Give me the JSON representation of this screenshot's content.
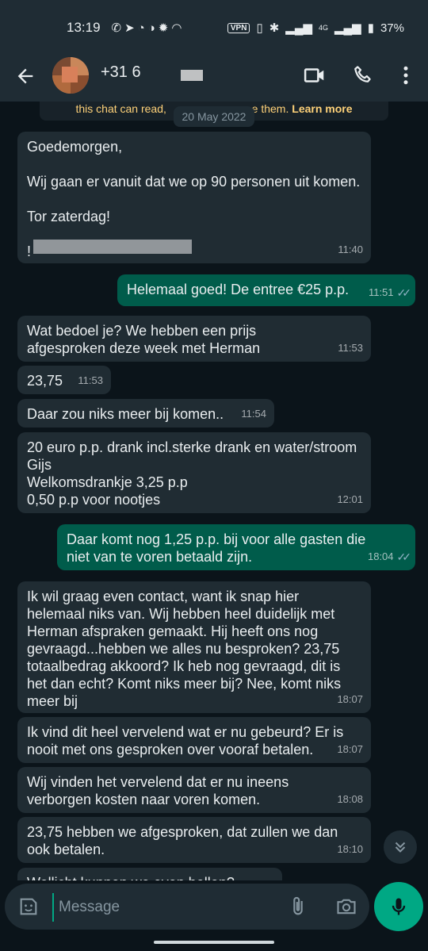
{
  "status_bar": {
    "time": "13:19",
    "notification_icons": [
      "whatsapp-icon",
      "telegram-icon",
      "c-icon",
      "opera-icon",
      "gear-icon",
      "arc-icon"
    ],
    "vpn": "VPN",
    "network": "4G",
    "battery": "37%"
  },
  "header": {
    "contact_name": "+31 6",
    "icons": [
      "back-arrow-icon",
      "video-call-icon",
      "phone-icon",
      "more-vert-icon"
    ]
  },
  "encryption_note": {
    "text_start": "this chat can read, ",
    "text_end": "e them.",
    "link": "Learn more"
  },
  "date_divider": "20 May 2022",
  "messages": [
    {
      "dir": "in",
      "text": "Goedemorgen,\n\nWij gaan er vanuit dat we op 90 personen uit komen.\n\nTor zaterdag!\n\n!",
      "time": "11:40"
    },
    {
      "dir": "out",
      "text": "Helemaal goed! De entree €25 p.p.",
      "time": "11:51",
      "read": true
    },
    {
      "dir": "in",
      "text": "Wat bedoel je? We hebben een prijs afgesproken deze week met Herman",
      "time": "11:53"
    },
    {
      "dir": "in",
      "text": "23,75",
      "time": "11:53"
    },
    {
      "dir": "in",
      "text": "Daar zou niks meer bij komen..",
      "time": "11:54"
    },
    {
      "dir": "in",
      "text": "20 euro p.p. drank incl.sterke drank en water/stroom Gijs\nWelkomsdrankje 3,25 p.p\n0,50 p.p voor nootjes",
      "time": "12:01"
    },
    {
      "dir": "out",
      "text": "Daar komt nog 1,25 p.p. bij voor alle gasten die niet van te voren betaald zijn.",
      "time": "18:04",
      "read": true
    },
    {
      "dir": "in",
      "text": "Ik wil graag even contact, want ik snap hier helemaal niks van. Wij hebben heel duidelijk met Herman afspraken gemaakt. Hij heeft ons nog gevraagd...hebben we alles nu besproken? 23,75 totaalbedrag akkoord? Ik heb nog gevraagd, dit is het dan echt? Komt niks meer bij? Nee, komt niks meer bij",
      "time": "18:07"
    },
    {
      "dir": "in",
      "text": "Ik vind dit heel vervelend wat er nu gebeurd? Er is nooit met ons gesproken over vooraf betalen.",
      "time": "18:07"
    },
    {
      "dir": "in",
      "text": "Wij vinden het vervelend dat er nu ineens verborgen kosten naar voren komen.",
      "time": "18:08"
    },
    {
      "dir": "in",
      "text": "23,75 hebben we afgesproken, dat zullen we dan ook betalen.",
      "time": "18:10"
    },
    {
      "dir": "in",
      "text": "Wellicht kunnen we even bellen?",
      "time": ""
    }
  ],
  "composer": {
    "placeholder": "Message",
    "icons": [
      "sticker-icon",
      "attach-icon",
      "camera-icon",
      "mic-icon"
    ]
  },
  "colors": {
    "background": "#0b141a",
    "incoming": "#202c33",
    "outgoing": "#005c4b",
    "accent": "#00a884"
  }
}
